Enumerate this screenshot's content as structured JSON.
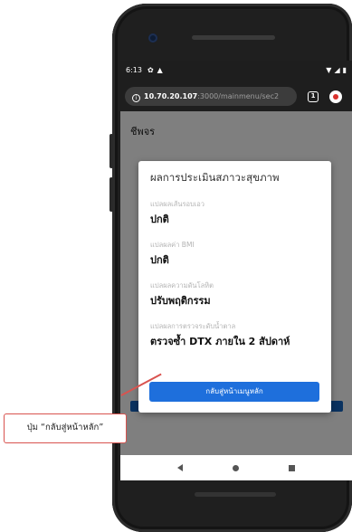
{
  "status_bar": {
    "time": "6:13",
    "left_glyphs": [
      "✿",
      "▲"
    ],
    "right_glyphs": [
      "▼",
      "◢",
      "▮"
    ]
  },
  "browser": {
    "url_host": "10.70.20.107",
    "url_path": ":3000/mainmenu/sec2",
    "info_glyph": "i",
    "tab_count": "1"
  },
  "page": {
    "title": "ชีพจร"
  },
  "modal": {
    "title": "ผลการประเมินสภาวะสุขภาพ",
    "items": [
      {
        "label": "แปลผลเส้นรอบเอว",
        "value": "ปกติ"
      },
      {
        "label": "แปลผลค่า BMI",
        "value": "ปกติ"
      },
      {
        "label": "แปลผลความดันโลหิต",
        "value": "ปรับพฤติกรรม"
      },
      {
        "label": "แปลผลการตรวจระดับน้ำตาล",
        "value": "ตรวจซ้ำ DTX ภายใน 2 สัปดาห์"
      }
    ],
    "home_button": "กลับสู่หน้าเมนูหลัก"
  },
  "nav_bar": {
    "back_icon": "back-triangle",
    "home_icon": "home-circle",
    "recent_icon": "recents-square"
  },
  "callout": {
    "text": "ปุ่ม “กลับสู่หน้าหลัก”",
    "color": "#d9534f"
  },
  "colors": {
    "primary_button": "#1e6fdc",
    "status_bar_bg": "#1e1e1e",
    "phone_body": "#1f1f1f"
  }
}
